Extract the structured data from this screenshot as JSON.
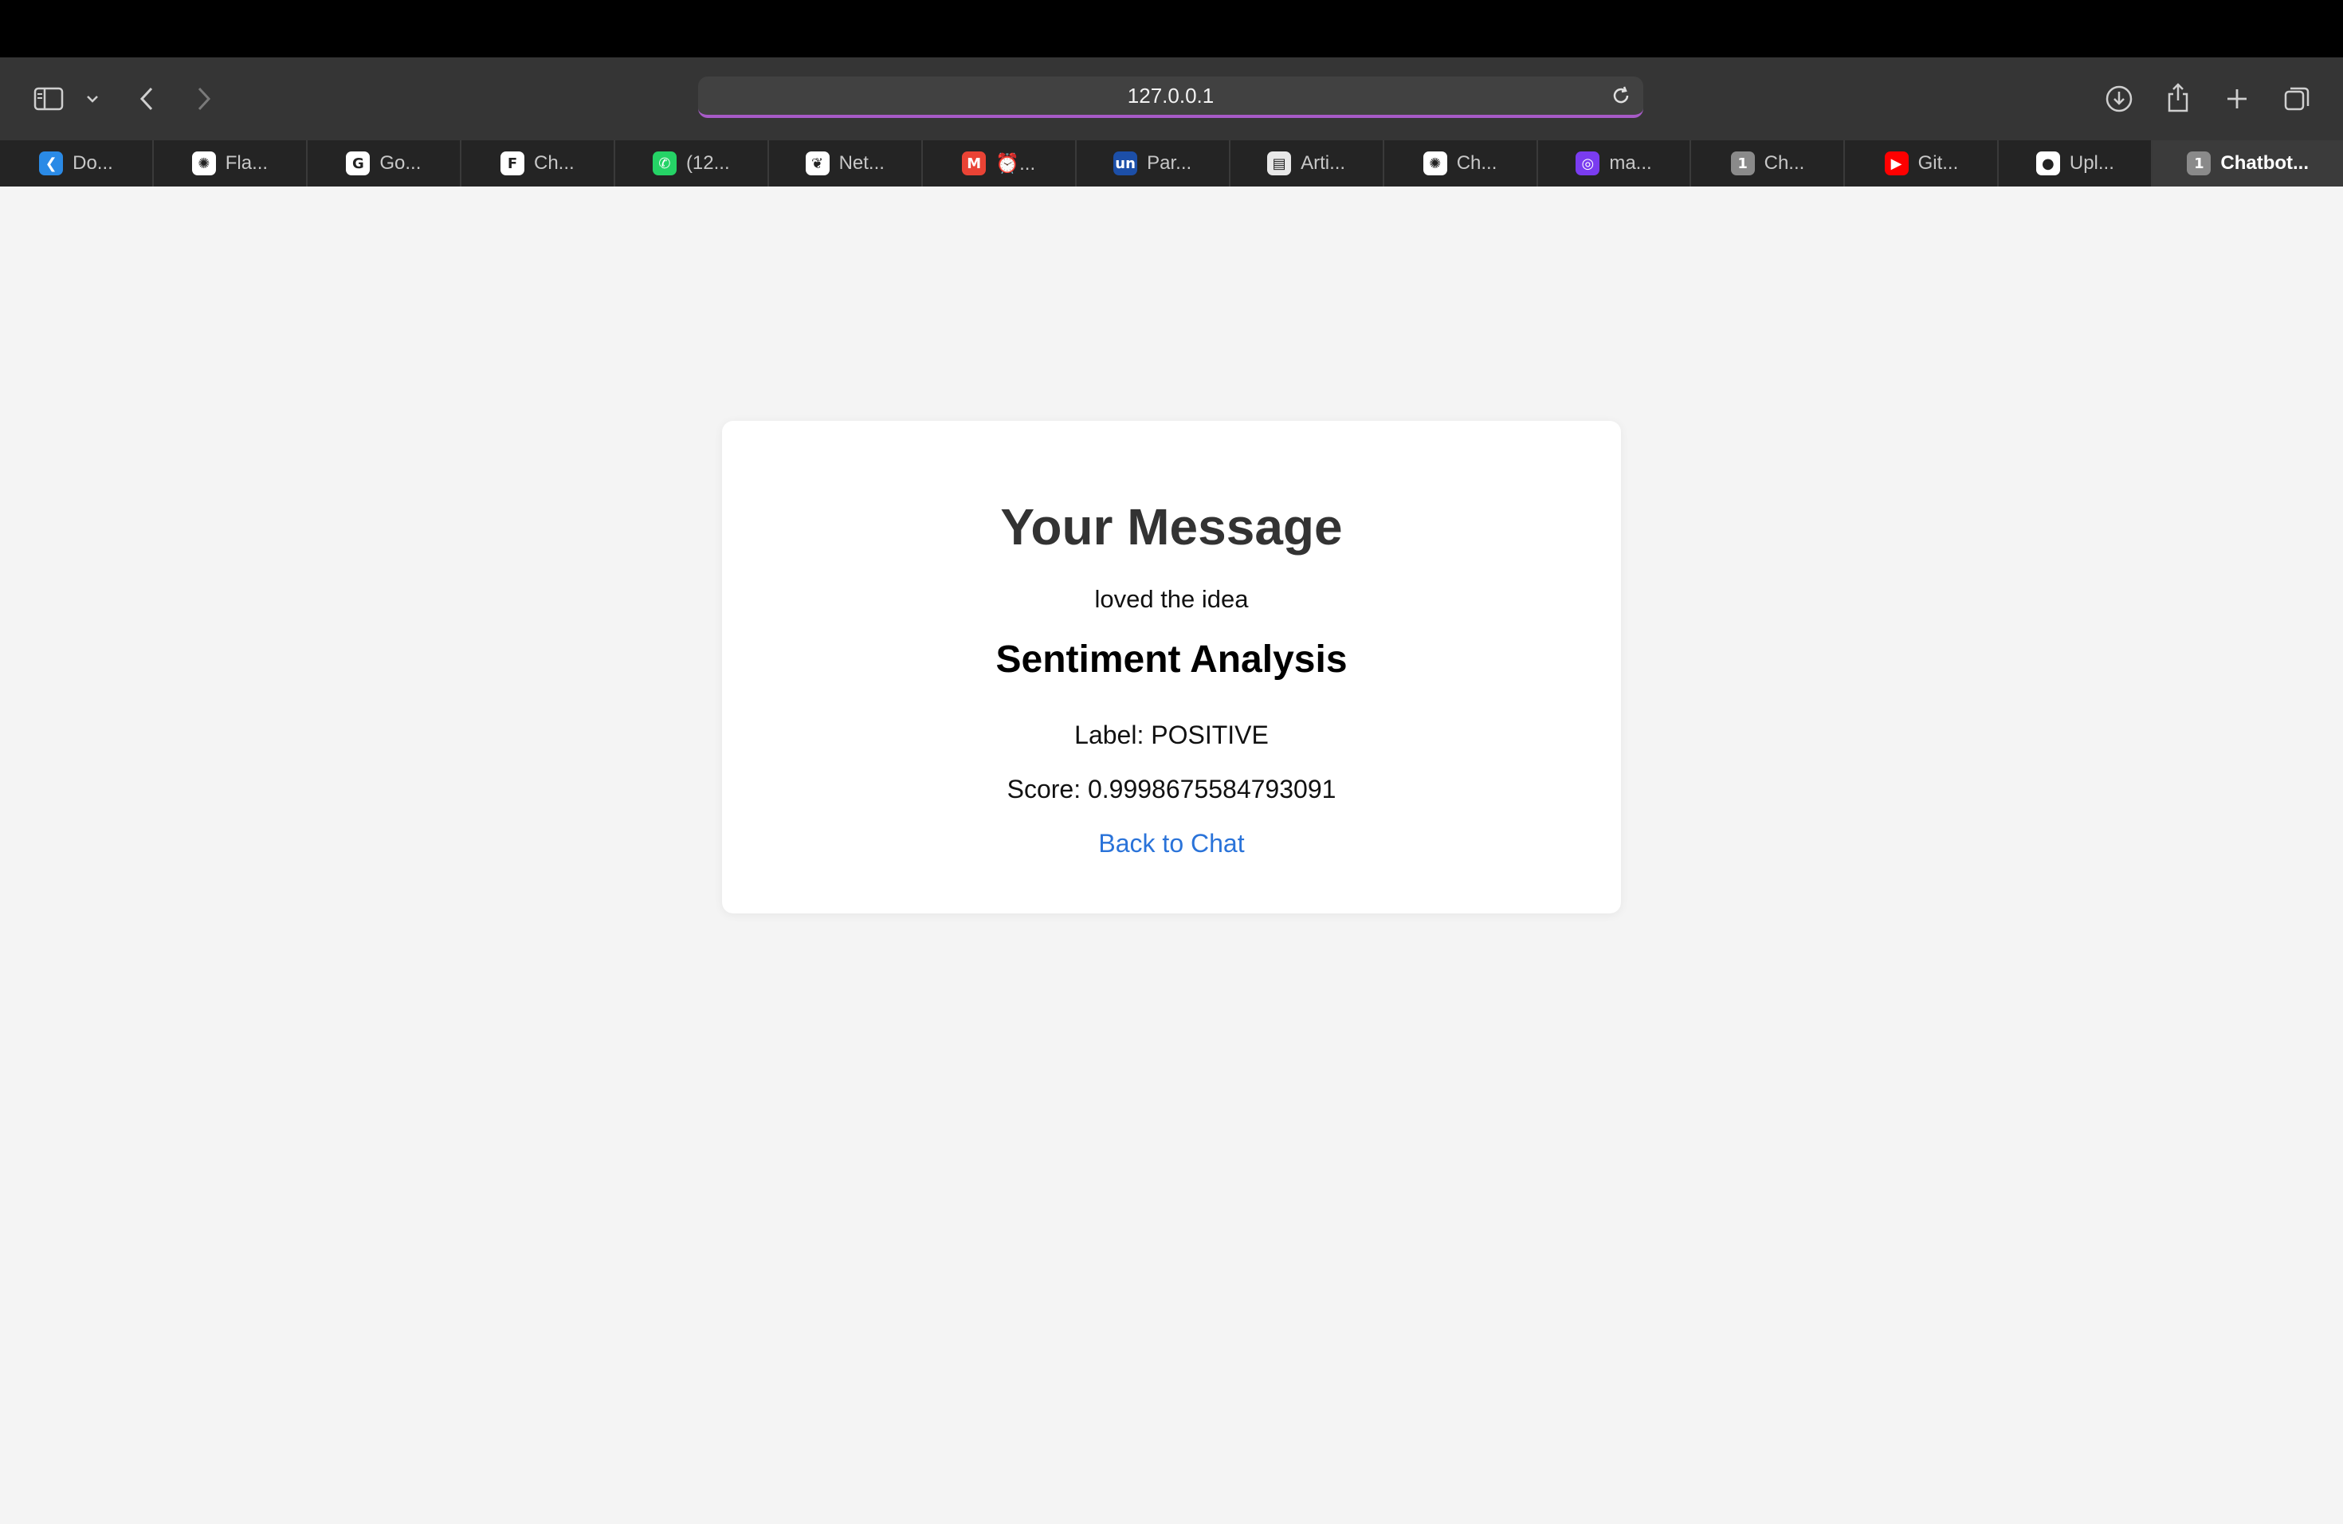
{
  "browser": {
    "url": "127.0.0.1",
    "accent_color": "#a75bc7",
    "tabs": [
      {
        "label": "Do...",
        "icon": "vscode-icon",
        "color": "#2a8ae6",
        "glyph": "❮"
      },
      {
        "label": "Fla...",
        "icon": "chatgpt-icon",
        "color": "#ffffff",
        "glyph": "✺"
      },
      {
        "label": "Go...",
        "icon": "google-icon",
        "color": "#ffffff",
        "glyph": "G"
      },
      {
        "label": "Ch...",
        "icon": "figma-icon",
        "color": "#ffffff",
        "glyph": "F"
      },
      {
        "label": "(12...",
        "icon": "whatsapp-icon",
        "color": "#25d366",
        "glyph": "✆"
      },
      {
        "label": "Net...",
        "icon": "mongodb-icon",
        "color": "#ffffff",
        "glyph": "❦"
      },
      {
        "label": "⏰...",
        "icon": "gmail-icon",
        "color": "#ea4335",
        "glyph": "M"
      },
      {
        "label": "Par...",
        "icon": "unstop-icon",
        "color": "#1c4fa8",
        "glyph": "un"
      },
      {
        "label": "Arti...",
        "icon": "article-icon",
        "color": "#e8e8e8",
        "glyph": "▤"
      },
      {
        "label": "Ch...",
        "icon": "chatgpt-icon",
        "color": "#ffffff",
        "glyph": "✺"
      },
      {
        "label": "ma...",
        "icon": "app-icon",
        "color": "#7a3cf0",
        "glyph": "◎"
      },
      {
        "label": "Ch...",
        "icon": "number-one-icon",
        "color": "#8a8a8a",
        "glyph": "1"
      },
      {
        "label": "Git...",
        "icon": "youtube-icon",
        "color": "#ff0000",
        "glyph": "▶"
      },
      {
        "label": "Upl...",
        "icon": "github-icon",
        "color": "#ffffff",
        "glyph": "●"
      },
      {
        "label": "Chatbot...",
        "icon": "number-one-icon",
        "color": "#8a8a8a",
        "glyph": "1"
      }
    ]
  },
  "page": {
    "heading": "Your Message",
    "message": "loved the idea",
    "subheading": "Sentiment Analysis",
    "label_line": "Label: POSITIVE",
    "score_line": "Score: 0.9998675584793091",
    "back_link": "Back to Chat",
    "link_color": "#2a73d9"
  }
}
